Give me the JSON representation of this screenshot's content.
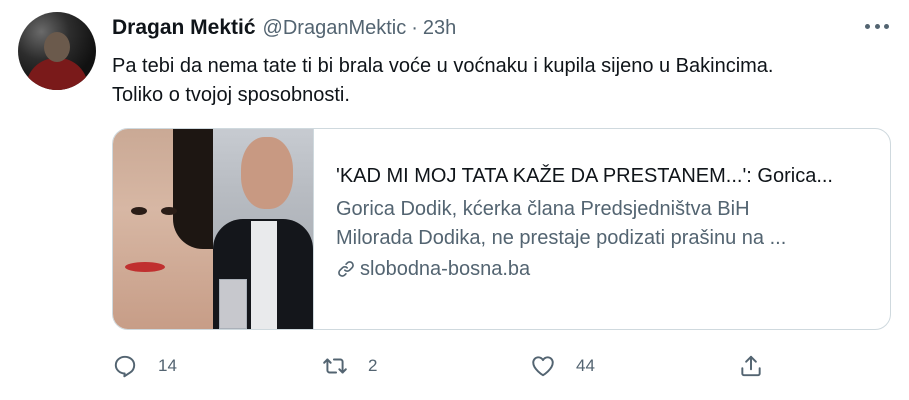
{
  "tweet": {
    "author": {
      "display_name": "Dragan Mektić",
      "handle": "@DraganMektic",
      "separator": "·",
      "time": "23h"
    },
    "text_line1": "Pa tebi da nema tate ti bi brala voće u voćnaku i kupila sijeno u Bakincima.",
    "text_line2": "Toliko o tvojoj sposobnosti.",
    "card": {
      "title": "'KAD MI MOJ TATA KAŽE DA PRESTANEM...': Gorica...",
      "description_line1": "Gorica Dodik, kćerka člana Predsjedništva BiH",
      "description_line2": "Milorada Dodika, ne prestaje podizati prašinu na ...",
      "domain": "slobodna-bosna.ba",
      "link_icon": "link-icon"
    },
    "actions": {
      "reply_count": "14",
      "retweet_count": "2",
      "like_count": "44",
      "reply_icon": "reply-icon",
      "retweet_icon": "retweet-icon",
      "like_icon": "heart-icon",
      "share_icon": "share-icon"
    },
    "colors": {
      "text": "#0f1419",
      "secondary": "#536471",
      "border": "#cfd9de"
    }
  }
}
